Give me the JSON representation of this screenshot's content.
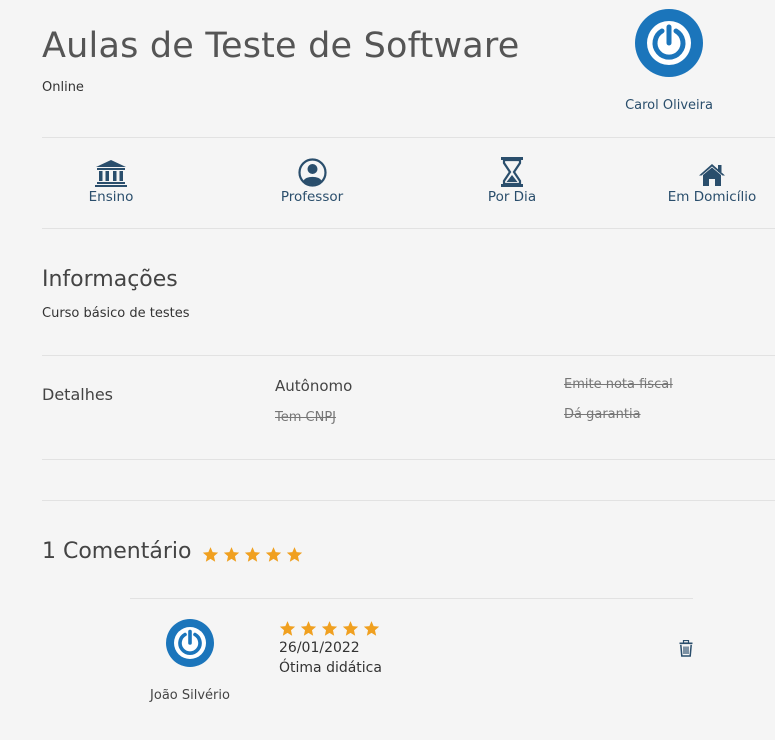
{
  "header": {
    "title": "Aulas de Teste de Software",
    "mode": "Online",
    "owner_name": "Carol Oliveira"
  },
  "features": [
    {
      "icon": "bank-icon",
      "label": "Ensino"
    },
    {
      "icon": "user-circle-icon",
      "label": "Professor"
    },
    {
      "icon": "hourglass-icon",
      "label": "Por Dia"
    },
    {
      "icon": "home-icon",
      "label": "Em Domicílio"
    }
  ],
  "info": {
    "title": "Informações",
    "description": "Curso básico de testes"
  },
  "details": {
    "label": "Detalhes",
    "items": [
      {
        "text": "Autônomo",
        "active": true
      },
      {
        "text": "Tem CNPJ",
        "active": false
      },
      {
        "text": "Emite nota fiscal",
        "active": false
      },
      {
        "text": "Dá garantia",
        "active": false
      }
    ]
  },
  "comments": {
    "title": "1 Comentário",
    "average_rating": 5,
    "star_color": "#f0a020",
    "reviews": [
      {
        "author": "João Silvério",
        "rating": 5,
        "date": "26/01/2022",
        "text": "Ótima didática"
      }
    ]
  },
  "colors": {
    "accent": "#2a4e6c",
    "avatar": "#1b75bb"
  }
}
